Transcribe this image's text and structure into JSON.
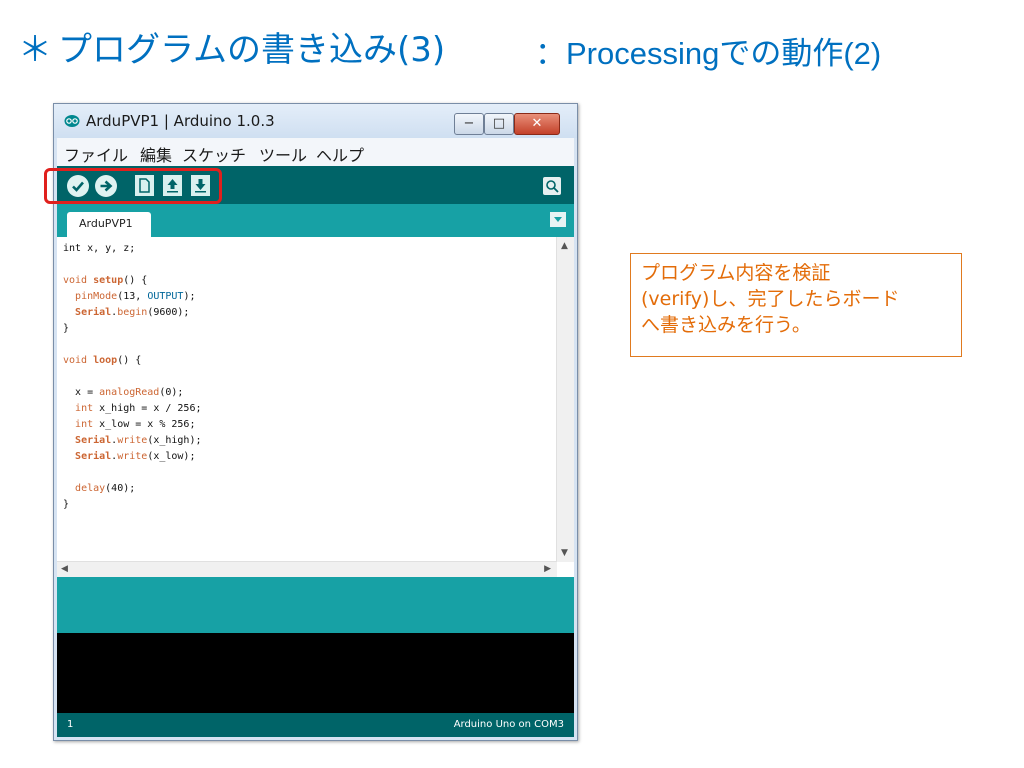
{
  "slide": {
    "bullet": "＊",
    "title": "プログラムの書き込み(3)",
    "subtitle": "：Processingでの動作(2)"
  },
  "window": {
    "title": "ArduPVP1 | Arduino 1.0.3",
    "icon": "arduino-infinity-icon",
    "controls": {
      "minimize": "−",
      "maximize": "□",
      "close": "✕"
    }
  },
  "menu": [
    "ファイル",
    "編集",
    "スケッチ",
    "ツール",
    "ヘルプ"
  ],
  "toolbar": {
    "icons": [
      "verify-icon",
      "upload-icon",
      "new-icon",
      "open-icon",
      "save-icon",
      "serial-monitor-icon"
    ]
  },
  "tab": {
    "label": "ArduPVP1"
  },
  "code_lines": [
    "int x, y, z;",
    "",
    "void setup() {",
    "  pinMode(13, OUTPUT);",
    "  Serial.begin(9600);",
    "}",
    "",
    "void loop() {",
    "",
    "  x = analogRead(0);",
    "  int x_high = x / 256;",
    "  int x_low = x % 256;",
    "  Serial.write(x_high);",
    "  Serial.write(x_low);",
    "",
    "  delay(40);",
    "}"
  ],
  "status": {
    "line": "1",
    "board": "Arduino Uno on COM3"
  },
  "callout": {
    "lines": [
      "プログラム内容を検証",
      "(verify)し、完了したらボード",
      "へ書き込みを行う。"
    ]
  },
  "colors": {
    "title": "#0070c0",
    "toolbar": "#006468",
    "tabbar": "#17a1a5",
    "highlight": "#e0201d",
    "callout": "#e36c09"
  }
}
